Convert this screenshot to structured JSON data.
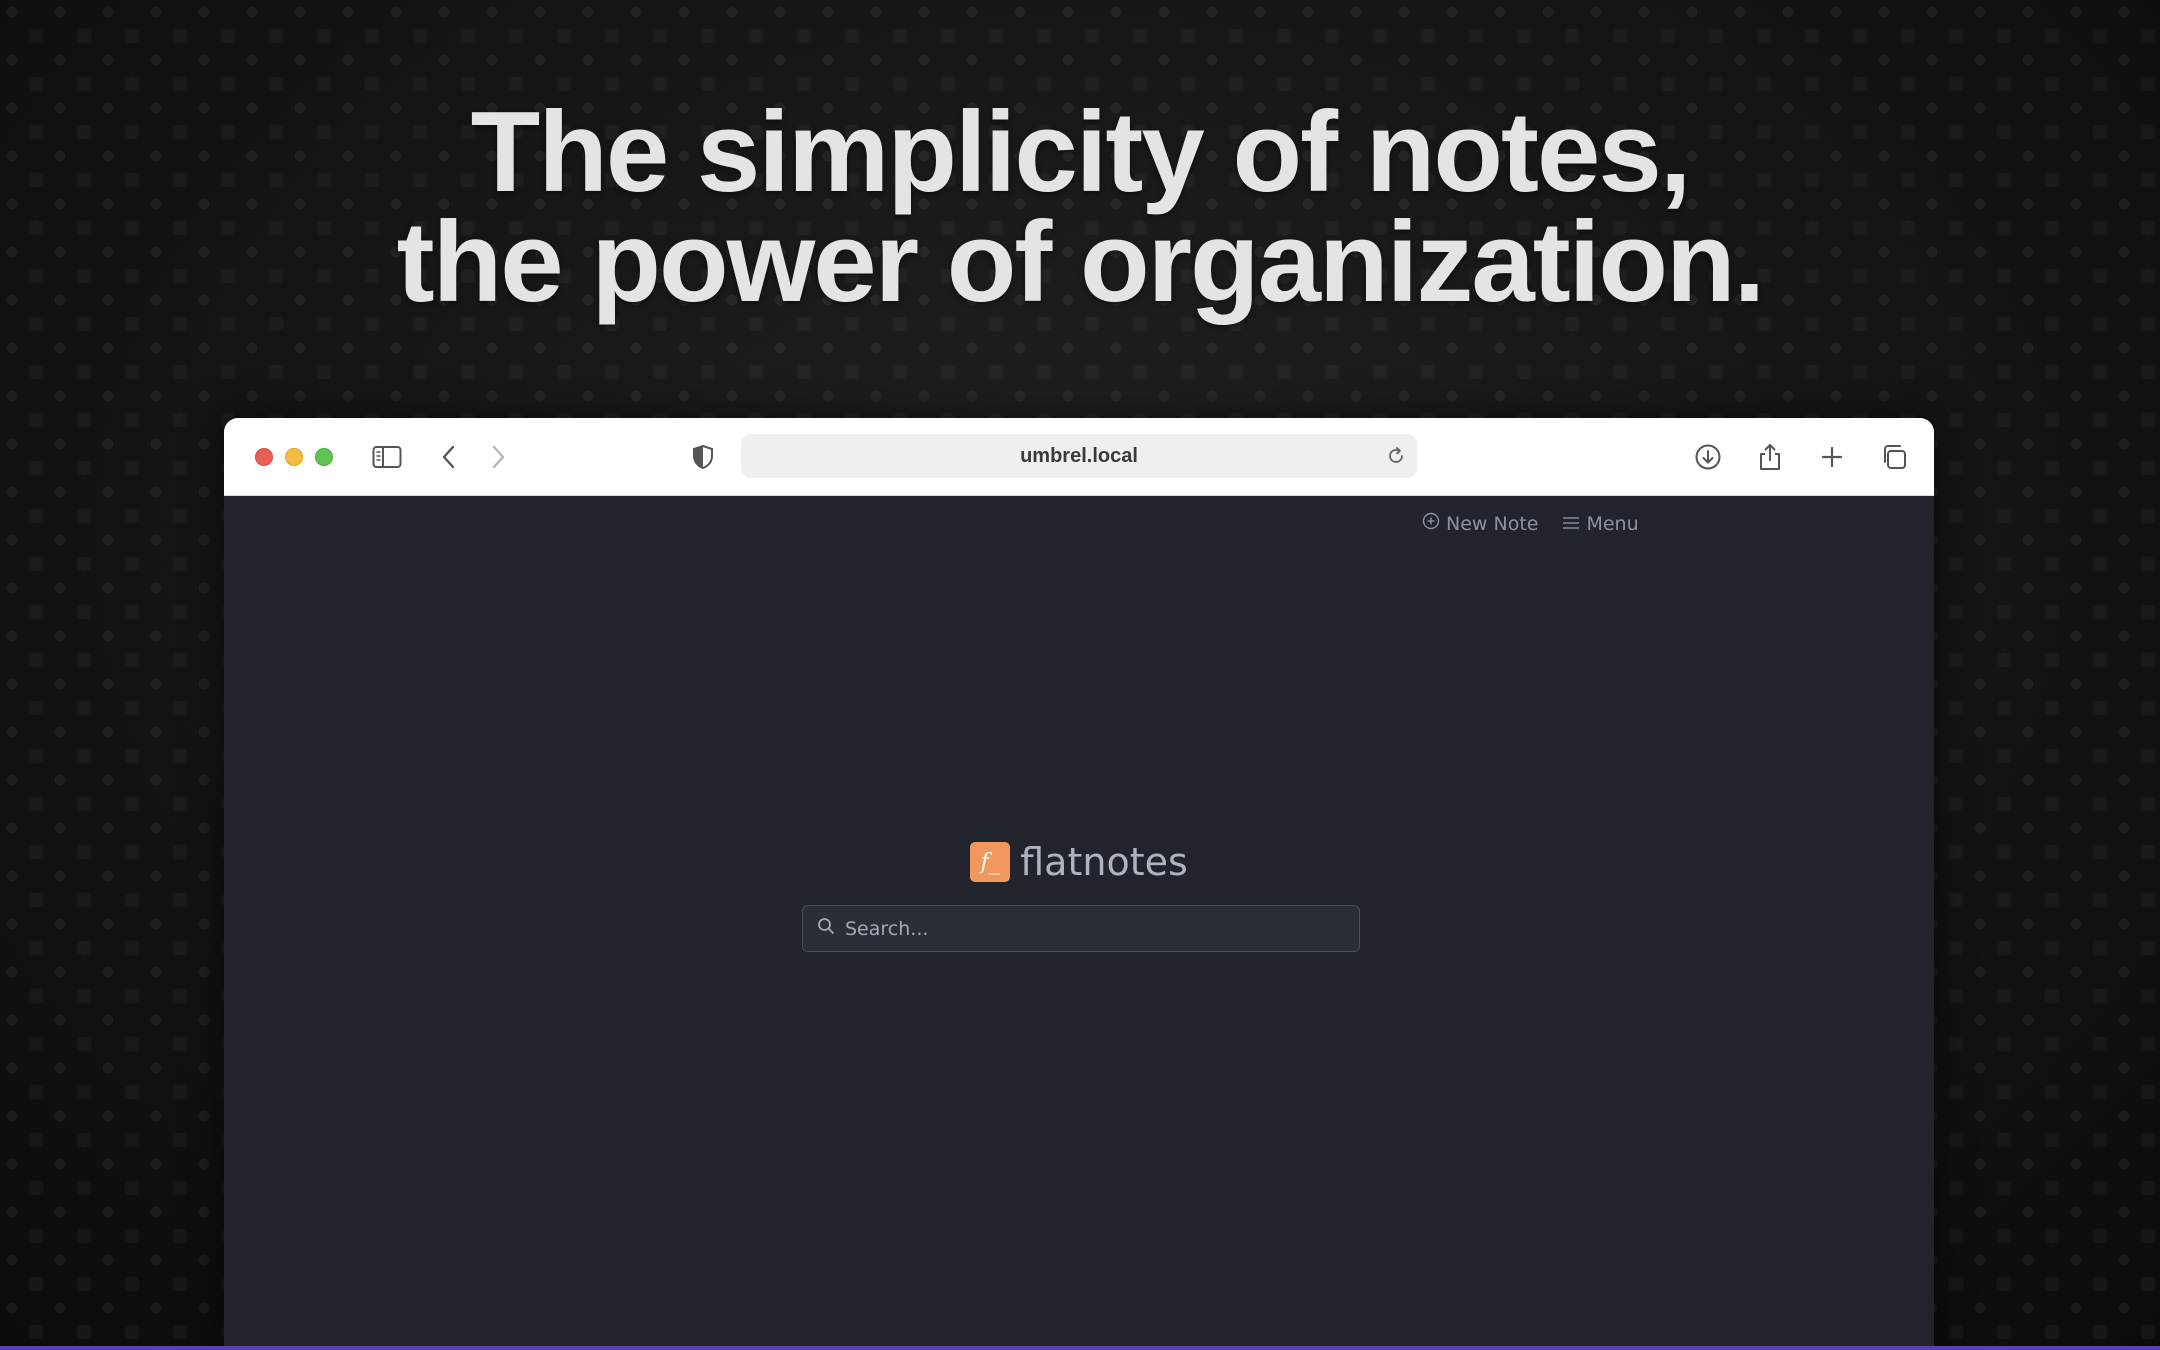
{
  "headline": {
    "line1": "The simplicity of notes,",
    "line2": "the power of organization."
  },
  "browser": {
    "url": "umbrel.local",
    "toolbar_icons": [
      "sidebar-icon",
      "back-icon",
      "forward-icon",
      "shield-icon",
      "reload-icon",
      "download-icon",
      "share-icon",
      "plus-icon",
      "tabs-icon"
    ]
  },
  "app": {
    "nav": {
      "new_note_label": "New Note",
      "menu_label": "Menu"
    },
    "brand": {
      "logo_glyph": "f_",
      "name": "flatnotes",
      "logo_color": "#f2975e"
    },
    "search": {
      "placeholder": "Search..."
    },
    "background_color": "#21242c"
  }
}
